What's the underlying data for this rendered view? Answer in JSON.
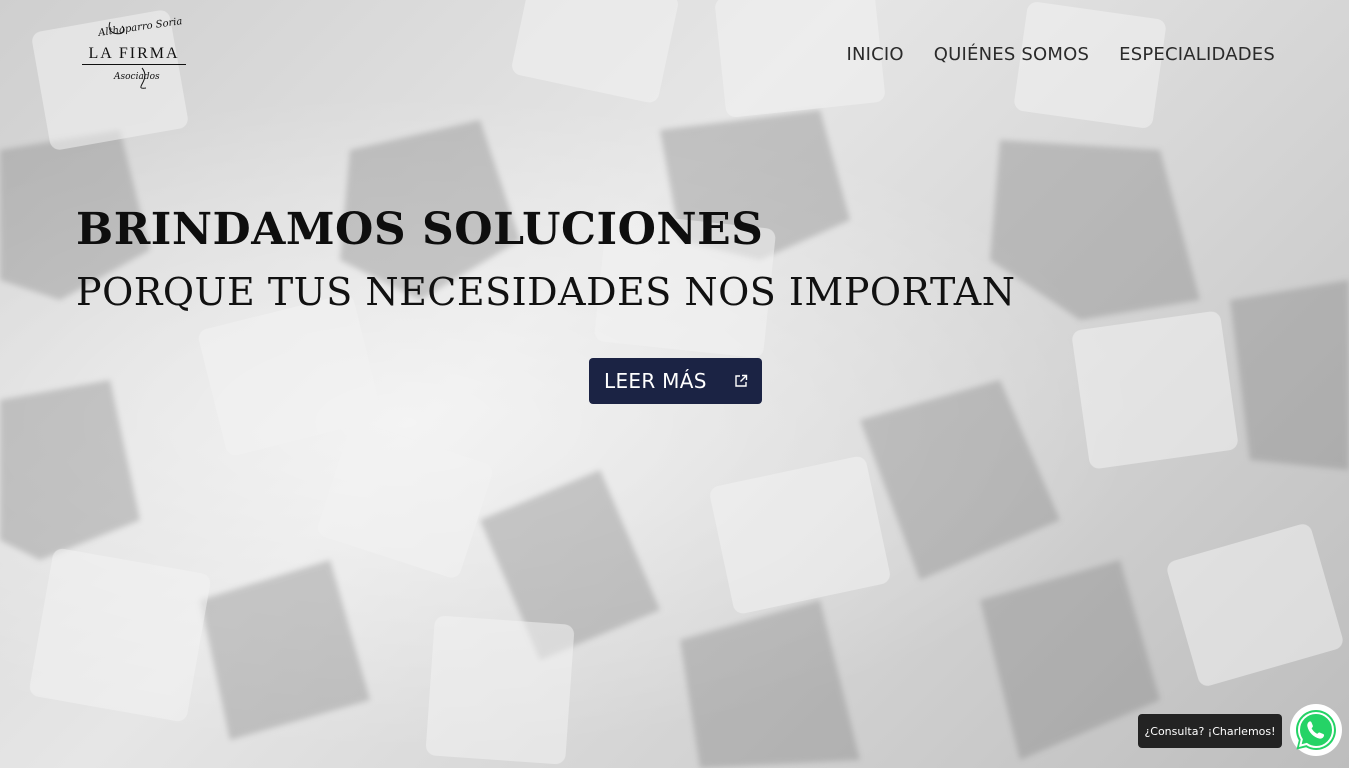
{
  "logo": {
    "script_top": "Althaparro Soria",
    "main": "LA FIRMA",
    "script_bottom": "Asociados"
  },
  "nav": {
    "items": [
      {
        "label": "INICIO"
      },
      {
        "label": "QUIÉNES SOMOS"
      },
      {
        "label": "ESPECIALIDADES"
      }
    ]
  },
  "hero": {
    "headline": "BRINDAMOS SOLUCIONES",
    "subheadline": "PORQUE TUS NECESIDADES NOS IMPORTAN",
    "cta_label": "LEER MÁS",
    "cta_icon": "external-link-icon",
    "background": "puzzle-pieces-image"
  },
  "chat": {
    "bubble_text": "¿Consulta? ¡Charlemos!",
    "icon": "whatsapp-icon"
  },
  "colors": {
    "cta_bg": "#1b2344",
    "whatsapp": "#25d366",
    "text_dark": "#111111"
  }
}
